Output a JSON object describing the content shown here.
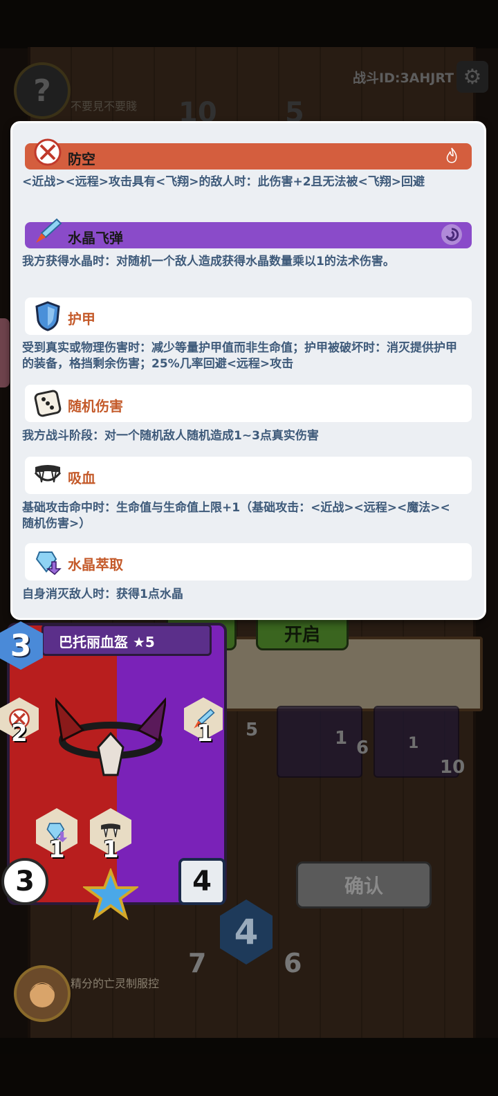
{
  "battle_id": "战斗ID:3AHJRT",
  "opponent": {
    "name": "不要見不要賤",
    "avatar_glyph": "?",
    "stat_left": "10",
    "stat_right": "5"
  },
  "keywords": [
    {
      "title": "防空",
      "style": "orange",
      "icon": "crossed-wing-icon",
      "badge": "fire-badge-icon",
      "desc": "<近战><远程>攻击具有<飞翔>的敌人时：此伤害+2且无法被<飞翔>回避"
    },
    {
      "title": "水晶飞弹",
      "style": "purple",
      "icon": "crystal-missile-icon",
      "badge": "arcane-badge-icon",
      "desc": "我方获得水晶时：对随机一个敌人造成获得水晶数量乘以1的法术伤害。"
    },
    {
      "title": "护甲",
      "style": "white",
      "icon": "shield-icon",
      "desc": "受到真实或物理伤害时：减少等量护甲值而非生命值；护甲被破坏时：消灭提供护甲的装备，格挡剩余伤害；25%几率回避<远程>攻击"
    },
    {
      "title": "随机伤害",
      "style": "white",
      "icon": "dice-icon",
      "desc": "我方战斗阶段：对一个随机敌人随机造成1~3点真实伤害"
    },
    {
      "title": "吸血",
      "style": "white",
      "icon": "fangs-icon",
      "desc": "基础攻击命中时：生命值与生命值上限+1（基础攻击：<近战><远程><魔法><随机伤害>）"
    },
    {
      "title": "水晶萃取",
      "style": "white",
      "icon": "crystal-extract-icon",
      "desc": "自身消灭敌人时：获得1点水晶"
    }
  ],
  "tabs": {
    "right_label": "开启"
  },
  "card": {
    "name": "巴托丽血盔 ★5",
    "cost": "3",
    "left_keyword_value": "2",
    "right_keyword_value": "1",
    "lower_left_value": "1",
    "lower_right_value": "1",
    "attack": "3",
    "armor": "4"
  },
  "confirm_label": "确认",
  "player": {
    "name": "精分的亡灵制服控",
    "crystal": "4",
    "stat_left": "7",
    "stat_right": "6"
  },
  "board_numbers": {
    "a": "5",
    "b": "1",
    "c": "6",
    "d": "1",
    "e": "10"
  }
}
